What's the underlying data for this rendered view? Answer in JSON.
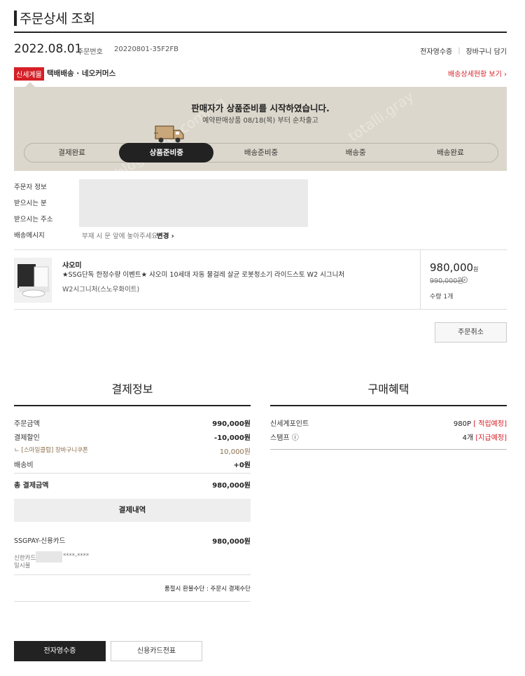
{
  "header": {
    "title": "주문상세 조회"
  },
  "order": {
    "date": "2022.08.01",
    "order_no_label": "주문번호",
    "order_no": "20220801-35F2FB",
    "links": [
      "전자영수증",
      "장바구니 담기"
    ]
  },
  "shipment": {
    "tag": "신세계몰",
    "info": "택배배송 · 네오커머스",
    "detail_link": "배송상세현황 보기 ›"
  },
  "status": {
    "title": "판매자가 상품준비를 시작하였습니다.",
    "subtitle": "예약판매상품 08/18(목) 부터 순차출고",
    "steps": [
      "결제완료",
      "상품준비중",
      "배송준비중",
      "배송중",
      "배송완료"
    ],
    "active_step": 1,
    "watermarks": [
      "blog.naver.com/ng",
      "totalli.gray"
    ]
  },
  "recipient": {
    "labels": [
      "주문자 정보",
      "받으시는 분",
      "받으시는 주소",
      "배송메시지"
    ],
    "memo": "부재 시 문 앞에 놓아주세요",
    "change_label": "변경 ›"
  },
  "product": {
    "brand": "샤오미",
    "name": "★SSG단독 한정수량 이벤트★ 샤오미 10세대 자동 물걸레 살균 로봇청소기 라이드스토 W2 시그니처",
    "option": "W2시그니처(스노우화이트)",
    "price": "980,000",
    "price_unit": "원",
    "orig_price": "990,000원",
    "qty": "수량 1개"
  },
  "cancel_button": "주문취소",
  "payment": {
    "title": "결제정보",
    "rows": [
      {
        "label": "주문금액",
        "value": "990,000원"
      },
      {
        "label": "결제할인",
        "value": "-10,000원"
      },
      {
        "label": "ㄴ [스마일클럽] 장바구니쿠폰",
        "value": "10,000원"
      },
      {
        "label": "배송비",
        "value": "+0원"
      }
    ],
    "total_label": "총 결제금액",
    "total_value": "980,000원",
    "history_title": "결제내역",
    "method_label": "SSGPAY-신용카드",
    "method_value": "980,000원",
    "card_label": "신한카드",
    "card_masked": "****-****",
    "installment": "일시불",
    "refund_note": "품절시 환불수단 : 주문시 결제수단"
  },
  "benefit": {
    "title": "구매혜택",
    "rows": [
      {
        "label": "신세계포인트",
        "value": "980P",
        "tag": "[ 적립예정]"
      },
      {
        "label": "스탬프 ⓘ",
        "value": "4개",
        "tag": "[지급예정]"
      }
    ]
  },
  "bottom_buttons": {
    "receipt": "전자영수증",
    "card_slip": "신용카드전표"
  },
  "colors": {
    "accent": "#d61f26",
    "status_bg": "#dcd7cc",
    "dark": "#222222"
  }
}
